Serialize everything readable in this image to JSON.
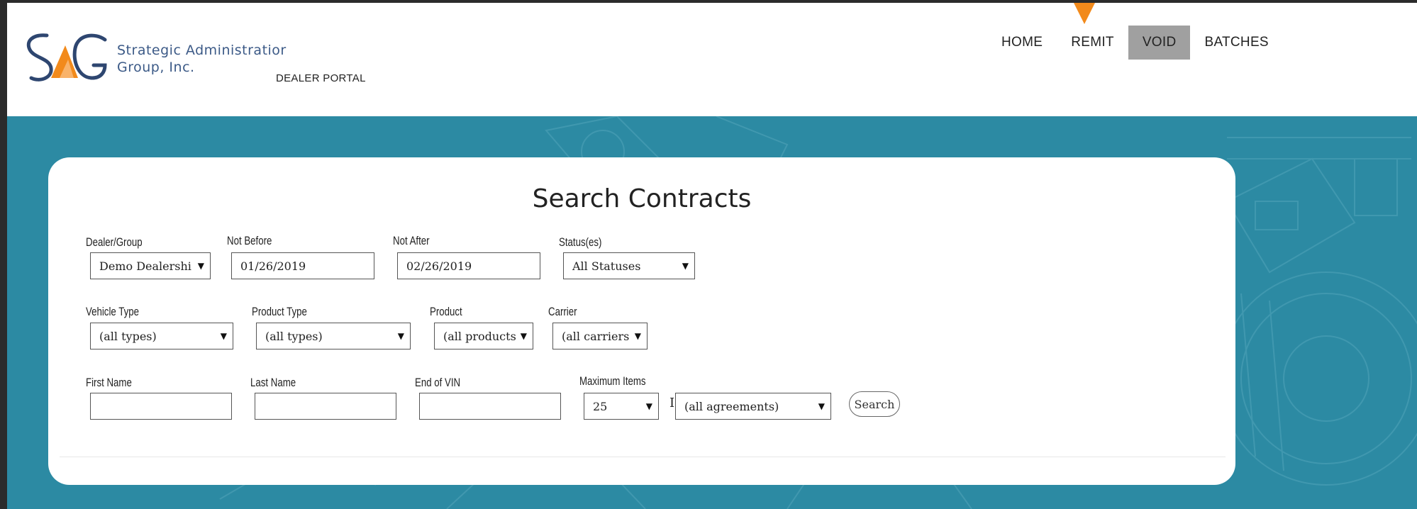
{
  "brand": {
    "name_line1": "Strategic Administratior",
    "name_line2": "Group, Inc.",
    "portal_label": "DEALER PORTAL",
    "colors": {
      "navy": "#2e4670",
      "orange": "#f28a1b"
    }
  },
  "nav": {
    "items": [
      {
        "label": "HOME"
      },
      {
        "label": "REMIT"
      },
      {
        "label": "VOID",
        "active": true
      },
      {
        "label": "BATCHES"
      }
    ],
    "active_color": "#a0a0a0"
  },
  "card": {
    "title": "Search Contracts",
    "fields": {
      "dealer_group": {
        "label": "Dealer/Group",
        "value": "Demo Dealershi"
      },
      "not_before": {
        "label": "Not Before",
        "value": "01/26/2019"
      },
      "not_after": {
        "label": "Not After",
        "value": "02/26/2019"
      },
      "statuses": {
        "label": "Status(es)",
        "value": "All Statuses"
      },
      "vehicle_type": {
        "label": "Vehicle Type",
        "value": "(all types)"
      },
      "product_type": {
        "label": "Product Type",
        "value": "(all types)"
      },
      "product": {
        "label": "Product",
        "value": "(all products"
      },
      "carrier": {
        "label": "Carrier",
        "value": "(all carriers"
      },
      "first_name": {
        "label": "First Name",
        "value": ""
      },
      "last_name": {
        "label": "Last Name",
        "value": ""
      },
      "end_of_vin": {
        "label": "End of VIN",
        "value": ""
      },
      "maximum_items": {
        "label": "Maximum Items",
        "value": "25"
      },
      "agreements": {
        "value": "(all agreements)"
      }
    },
    "stray_text": "I",
    "search_button": "Search"
  },
  "colors": {
    "background_teal": "#2c8aa3",
    "frame_dark": "#2b2b2b"
  }
}
